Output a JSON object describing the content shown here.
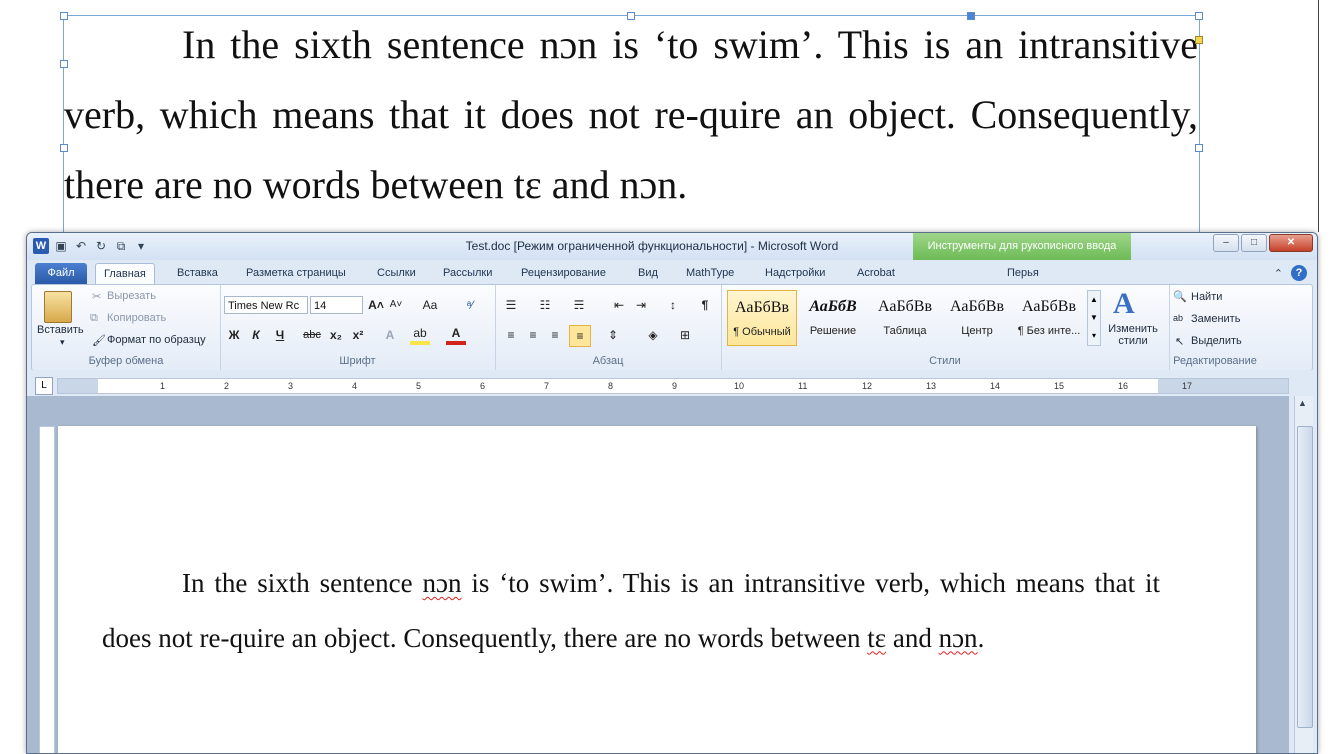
{
  "background_doc": {
    "text_parts": [
      "In the sixth sentence nɔn is ‘to swim’. This is an intransitive verb, which means that it does not re-quire an object. Consequently, there are no words between tɛ and nɔn."
    ]
  },
  "window": {
    "title": "Test.doc [Режим ограниченной функциональности]  -  Microsoft Word",
    "contextual_tab_group": "Инструменты для рукописного ввода",
    "controls": {
      "minimize": "–",
      "maximize": "□",
      "close": "✕"
    }
  },
  "tabs": {
    "file": "Файл",
    "items": [
      "Главная",
      "Вставка",
      "Разметка страницы",
      "Ссылки",
      "Рассылки",
      "Рецензирование",
      "Вид",
      "MathType",
      "Надстройки",
      "Acrobat",
      "Перья"
    ]
  },
  "ribbon": {
    "clipboard": {
      "paste": "Вставить",
      "cut": "Вырезать",
      "copy": "Копировать",
      "format_painter": "Формат по образцу",
      "label": "Буфер обмена"
    },
    "font": {
      "font_name": "Times New Rc",
      "font_size": "14",
      "label": "Шрифт",
      "bold": "Ж",
      "italic": "К",
      "underline": "Ч",
      "strike": "abc",
      "subscript": "x₂",
      "superscript": "x²",
      "change_case": "Aa"
    },
    "paragraph": {
      "label": "Абзац",
      "show_marks": "¶"
    },
    "styles": {
      "label": "Стили",
      "items": [
        {
          "sample": "АаБбВв",
          "name": "¶ Обычный"
        },
        {
          "sample": "АаБбВ",
          "name": "Решение"
        },
        {
          "sample": "АаБбВв",
          "name": "Таблица"
        },
        {
          "sample": "АаБбВв",
          "name": "Центр"
        },
        {
          "sample": "АаБбВв",
          "name": "¶ Без инте..."
        }
      ],
      "change_styles": "Изменить стили"
    },
    "editing": {
      "label": "Редактирование",
      "find": "Найти",
      "replace": "Заменить",
      "select": "Выделить"
    }
  },
  "ruler": {
    "numbers": [
      "1",
      "2",
      "3",
      "4",
      "5",
      "6",
      "7",
      "8",
      "9",
      "10",
      "11",
      "12",
      "13",
      "14",
      "15",
      "16",
      "17"
    ]
  },
  "document": {
    "text_a": "In the sixth sentence ",
    "word_non1": "nɔn",
    "text_b": " is ‘to swim’. This is an intransitive verb, which means that it does not re-quire an object. Consequently, there are no words between ",
    "word_te": "tɛ",
    "text_c": " and ",
    "word_non2": "nɔn",
    "text_d": "."
  },
  "colors": {
    "file_tab": "#2a5aa8",
    "ink_tools": "#6dbb55",
    "close_button": "#c5412b"
  }
}
